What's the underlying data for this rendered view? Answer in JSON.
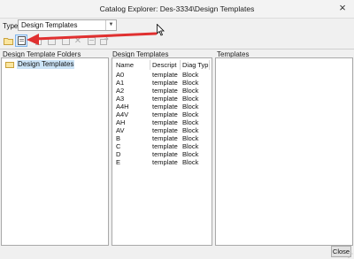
{
  "window": {
    "title": "Catalog Explorer: Des-3334\\Design Templates",
    "close_icon": "close-icon"
  },
  "typebar": {
    "label": "Type:",
    "selected": "Design Templates"
  },
  "toolbar": {
    "buttons": [
      "new-folder-icon",
      "new-template-icon",
      "copy-icon",
      "paste-icon",
      "properties-icon",
      "delete-icon",
      "cut-icon",
      "export-icon"
    ]
  },
  "panels": {
    "folders_label": "Design Template Folders",
    "templates_list_label": "Design Templates",
    "templates_label": "Templates"
  },
  "tree": {
    "root": "Design Templates"
  },
  "table": {
    "headers": [
      "Name",
      "Descript",
      "Diag Typ"
    ],
    "rows": [
      [
        "A0",
        "template",
        "Block"
      ],
      [
        "A1",
        "template",
        "Block"
      ],
      [
        "A2",
        "template",
        "Block"
      ],
      [
        "A3",
        "template",
        "Block"
      ],
      [
        "A4H",
        "template",
        "Block"
      ],
      [
        "A4V",
        "template",
        "Block"
      ],
      [
        "AH",
        "template",
        "Block"
      ],
      [
        "AV",
        "template",
        "Block"
      ],
      [
        "B",
        "template",
        "Block"
      ],
      [
        "C",
        "template",
        "Block"
      ],
      [
        "D",
        "template",
        "Block"
      ],
      [
        "E",
        "template",
        "Block"
      ]
    ]
  },
  "footer": {
    "close_label": "Close"
  },
  "colors": {
    "annotation_arrow": "#e03030",
    "selection": "#cce4f7"
  }
}
